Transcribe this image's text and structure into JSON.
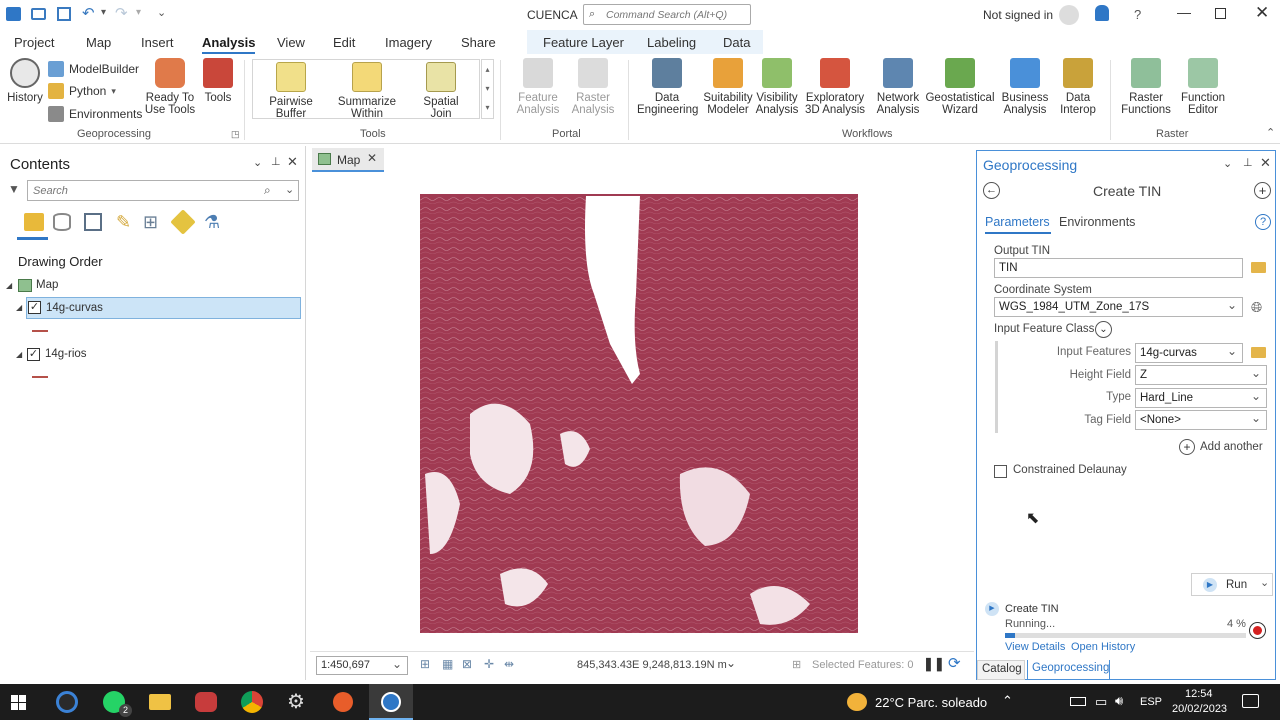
{
  "titlebar": {
    "project_name": "CUENCA",
    "command_search_placeholder": "Command Search (Alt+Q)",
    "signin": "Not signed in",
    "help": "?"
  },
  "tabs": [
    "Project",
    "Map",
    "Insert",
    "Analysis",
    "View",
    "Edit",
    "Imagery",
    "Share"
  ],
  "active_tab": "Analysis",
  "context_tabs": [
    "Feature Layer",
    "Labeling",
    "Data"
  ],
  "ribbon": {
    "geoprocessing": {
      "history": "History",
      "modelbuilder": "ModelBuilder",
      "python": "Python",
      "environments": "Environments",
      "ready_to_use_1": "Ready To",
      "ready_to_use_2": "Use Tools",
      "tools": "Tools",
      "label": "Geoprocessing"
    },
    "tools_gallery": {
      "pairwise_1": "Pairwise",
      "pairwise_2": "Buffer",
      "summarize_1": "Summarize",
      "summarize_2": "Within",
      "spatial_1": "Spatial",
      "spatial_2": "Join",
      "label": "Tools"
    },
    "portal": {
      "feature_1": "Feature",
      "feature_2": "Analysis",
      "raster_1": "Raster",
      "raster_2": "Analysis",
      "label": "Portal"
    },
    "workflows": {
      "items": [
        {
          "l1": "Data",
          "l2": "Engineering"
        },
        {
          "l1": "Suitability",
          "l2": "Modeler"
        },
        {
          "l1": "Visibility",
          "l2": "Analysis"
        },
        {
          "l1": "Exploratory",
          "l2": "3D Analysis"
        },
        {
          "l1": "Network",
          "l2": "Analysis"
        },
        {
          "l1": "Geostatistical",
          "l2": "Wizard"
        },
        {
          "l1": "Business",
          "l2": "Analysis"
        },
        {
          "l1": "Data",
          "l2": "Interop"
        }
      ],
      "label": "Workflows"
    },
    "raster": {
      "raster_fn_1": "Raster",
      "raster_fn_2": "Functions",
      "fn_editor_1": "Function",
      "fn_editor_2": "Editor",
      "label": "Raster"
    }
  },
  "contents": {
    "title": "Contents",
    "search_placeholder": "Search",
    "drawing_order": "Drawing Order",
    "map_item": "Map",
    "layers": [
      {
        "name": "14g-curvas",
        "checked": true,
        "selected": true
      },
      {
        "name": "14g-rios",
        "checked": true,
        "selected": false
      }
    ]
  },
  "map": {
    "tab_label": "Map",
    "scale": "1:450,697",
    "coordinates": "845,343.43E 9,248,813.19N m",
    "selected_features": "Selected Features: 0"
  },
  "geoprocessing_pane": {
    "pane_title": "Geoprocessing",
    "tool_title": "Create TIN",
    "tab_parameters": "Parameters",
    "tab_environments": "Environments",
    "output_tin_label": "Output TIN",
    "output_tin_value": "TIN",
    "coord_sys_label": "Coordinate System",
    "coord_sys_value": "WGS_1984_UTM_Zone_17S",
    "input_fc_label": "Input Feature Class",
    "input_features_label": "Input Features",
    "input_features_value": "14g-curvas",
    "height_field_label": "Height Field",
    "height_field_value": "Z",
    "type_label": "Type",
    "type_value": "Hard_Line",
    "tag_field_label": "Tag Field",
    "tag_field_value": "<None>",
    "add_another": "Add another",
    "constrained_delaunay": "Constrained Delaunay",
    "run": "Run",
    "progress_title": "Create TIN",
    "progress_status": "Running...",
    "progress_percent": "4 %",
    "progress_fraction": 0.04,
    "view_details": "View Details",
    "open_history": "Open History",
    "bottom_tab_catalog": "Catalog",
    "bottom_tab_geoprocessing": "Geoprocessing"
  },
  "taskbar": {
    "weather": "22°C  Parc. soleado",
    "language": "ESP",
    "time": "12:54",
    "date": "20/02/2023",
    "whatsapp_badge": "2"
  },
  "colors": {
    "accent": "#2f77c6",
    "map_fill": "#a03a52",
    "taskbar": "#1c1c1c",
    "selected_layer": "#cce4f7"
  }
}
